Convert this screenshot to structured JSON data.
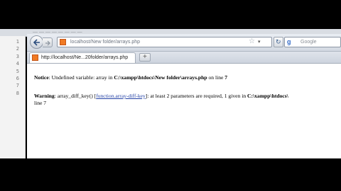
{
  "editor": {
    "top_text": "— — — — — — — —",
    "line_numbers": [
      "1",
      "2",
      "3",
      "4",
      "5",
      "6",
      "7",
      "8"
    ]
  },
  "browser": {
    "url_host": "localhost/New folder/arrays.php",
    "search_engine": "Google",
    "tab_title": "http://localhost/Ne...20folder/arrays.php",
    "new_tab": "+"
  },
  "page": {
    "notice": {
      "label": "Notice",
      "text1": ": Undefined variable: array in ",
      "path": "C:\\xampp\\htdocs\\New folder\\arrays.php",
      "text2": " on line ",
      "line": "7"
    },
    "warning": {
      "label": "Warning",
      "text1": ": array_diff_key() [",
      "link": "function.array-diff-key",
      "text2": "]: at least 2 parameters are required, 1 given in ",
      "path": "C:\\xampp\\htdocs\\",
      "line_text": "line 7"
    }
  }
}
